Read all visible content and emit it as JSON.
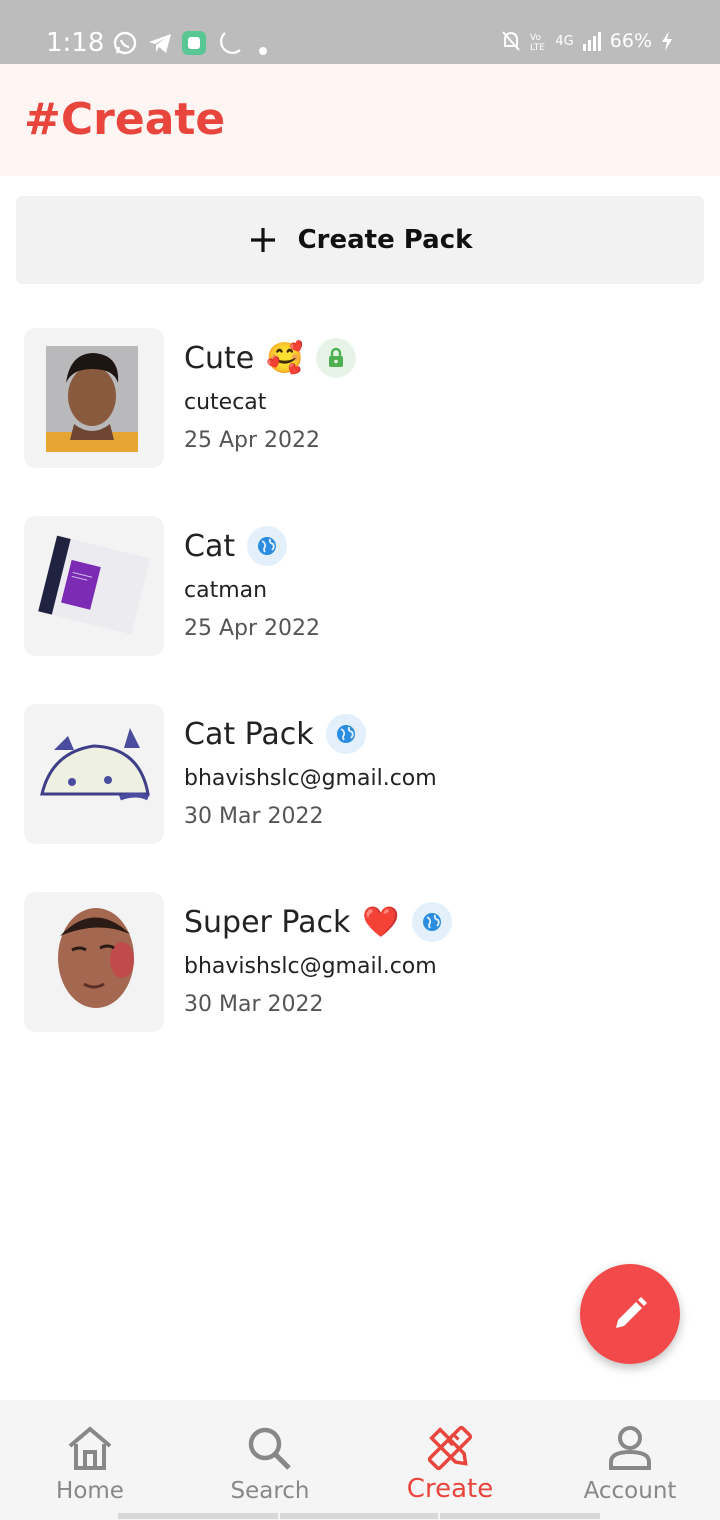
{
  "status_bar": {
    "time": "1:18",
    "battery": "66%",
    "network": "4G"
  },
  "app_bar": {
    "title": "#Create"
  },
  "create_button": {
    "label": "Create Pack"
  },
  "packs": [
    {
      "name": "Cute",
      "emoji": "🥰",
      "visibility": "private",
      "author": "cutecat",
      "date": "25 Apr 2022"
    },
    {
      "name": "Cat",
      "emoji": "",
      "visibility": "public",
      "author": "catman",
      "date": "25 Apr 2022"
    },
    {
      "name": "Cat Pack",
      "emoji": "",
      "visibility": "public",
      "author": "bhavishslc@gmail.com",
      "date": "30 Mar 2022"
    },
    {
      "name": "Super Pack",
      "emoji": "❤️",
      "visibility": "public",
      "author": "bhavishslc@gmail.com",
      "date": "30 Mar 2022"
    }
  ],
  "bottom_nav": [
    {
      "label": "Home",
      "icon": "home-icon"
    },
    {
      "label": "Search",
      "icon": "search-icon"
    },
    {
      "label": "Create",
      "icon": "create-tools-icon",
      "active": true
    },
    {
      "label": "Account",
      "icon": "account-icon"
    }
  ],
  "colors": {
    "accent": "#e8453c",
    "fab": "#f24a4a",
    "private_badge": "#4caf50",
    "public_badge": "#2b8de0"
  }
}
